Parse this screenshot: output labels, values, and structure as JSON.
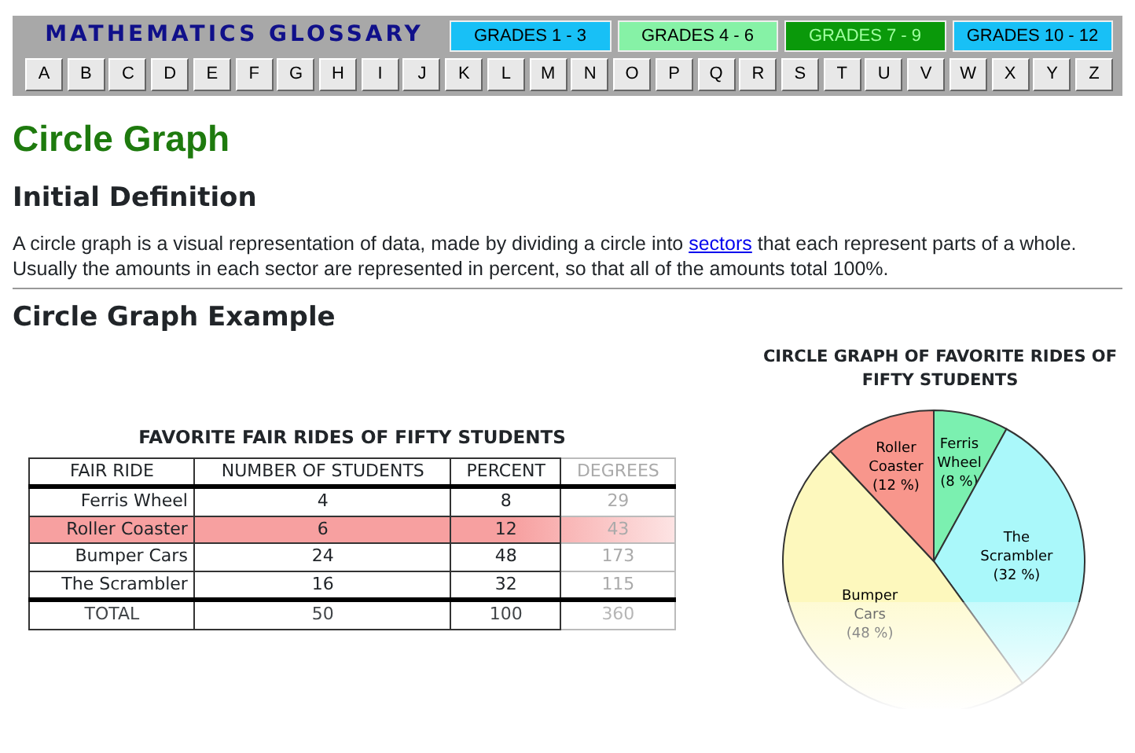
{
  "header": {
    "title": "MATHEMATICS GLOSSARY",
    "grades": [
      {
        "label": "GRADES  1 - 3",
        "color": "#18c0f6"
      },
      {
        "label": "GRADES  4 - 6",
        "color": "#86f2a6"
      },
      {
        "label": "GRADES  7 - 9",
        "color": "#0a990a"
      },
      {
        "label": "GRADES  10 - 12",
        "color": "#18c0f6"
      }
    ],
    "letters": [
      "A",
      "B",
      "C",
      "D",
      "E",
      "F",
      "G",
      "H",
      "I",
      "J",
      "K",
      "L",
      "M",
      "N",
      "O",
      "P",
      "Q",
      "R",
      "S",
      "T",
      "U",
      "V",
      "W",
      "X",
      "Y",
      "Z"
    ]
  },
  "page_title": "Circle Graph",
  "definition": {
    "heading": "Initial Definition",
    "before_link": "A circle graph is a visual representation of data, made by dividing a circle into",
    "link": "sectors",
    "after_link": "that each represent parts of a whole. Usually the amounts in each sector are represented in percent, so that all of the amounts total 100%."
  },
  "example": {
    "heading": "Circle Graph Example",
    "table": {
      "title": "FAVORITE FAIR RIDES OF FIFTY STUDENTS",
      "columns": [
        "FAIR RIDE",
        "NUMBER OF STUDENTS",
        "PERCENT",
        "DEGREES"
      ],
      "rows": [
        {
          "cells": [
            "Ferris Wheel",
            "4",
            "8",
            "29"
          ],
          "highlighted": false
        },
        {
          "cells": [
            "Roller Coaster",
            "6",
            "12",
            "43"
          ],
          "highlighted": true
        },
        {
          "cells": [
            "Bumper Cars",
            "24",
            "48",
            "173"
          ],
          "highlighted": false
        },
        {
          "cells": [
            "The Scrambler",
            "16",
            "32",
            "115"
          ],
          "highlighted": false
        }
      ],
      "total": [
        "TOTAL",
        "50",
        "100",
        "360"
      ]
    },
    "chart": {
      "chart_data": {
        "type": "pie",
        "title": "CIRCLE GRAPH OF FAVORITE RIDES OF FIFTY STUDENTS",
        "categories": [
          "Ferris Wheel",
          "The Scrambler",
          "Bumper Cars",
          "Roller Coaster"
        ],
        "values": [
          8,
          32,
          48,
          12
        ],
        "colors": [
          "#7bf0b0",
          "#aaf8fa",
          "#fdf8bd",
          "#f8968c"
        ],
        "value_labels": [
          "(8 %)",
          "(32 %)",
          "(48 %)",
          "(12 %)"
        ]
      }
    }
  }
}
